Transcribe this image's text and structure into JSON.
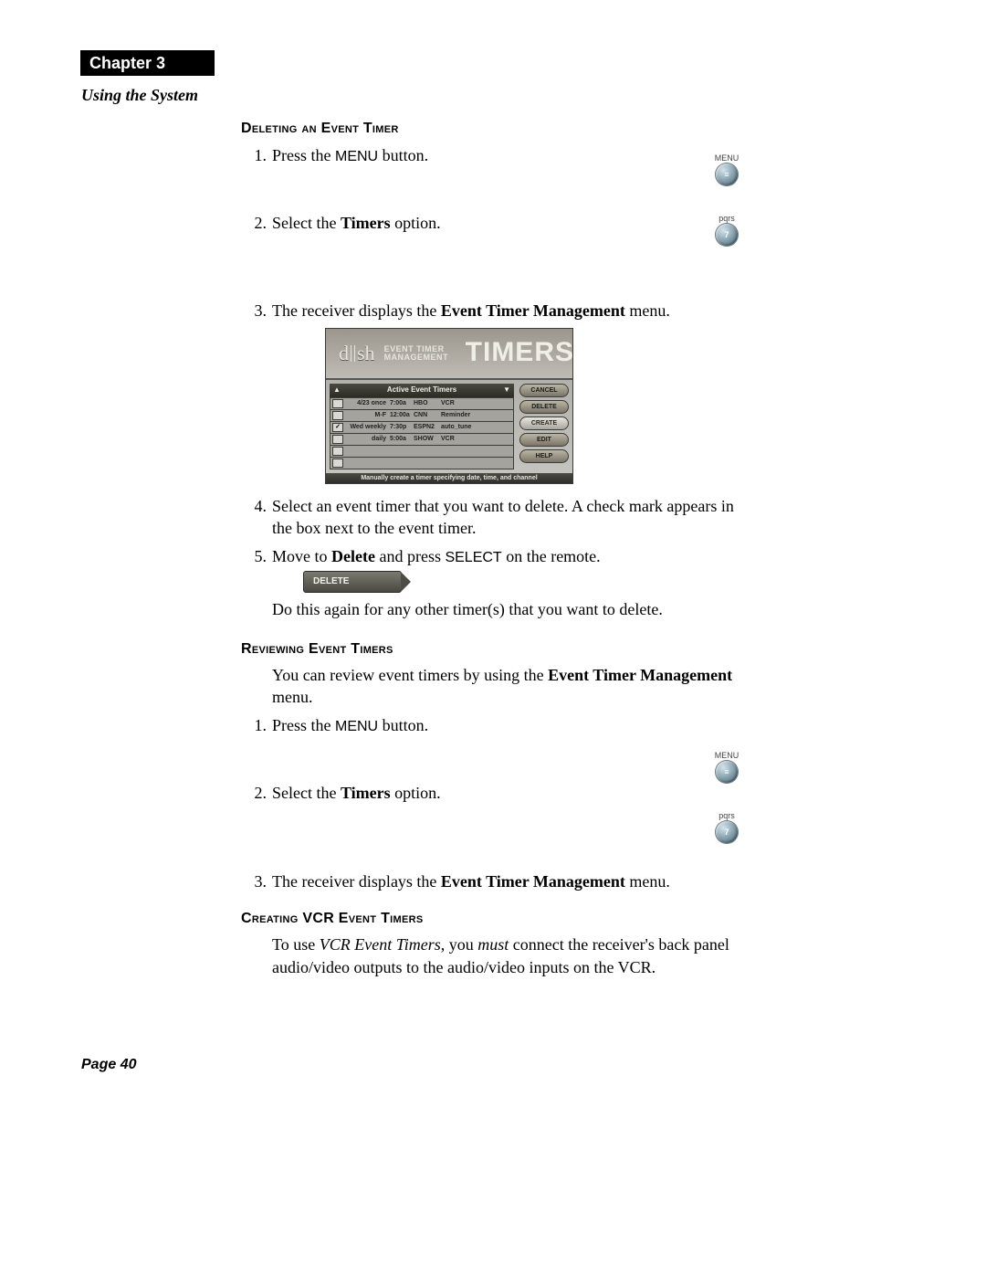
{
  "chapter": {
    "label": "Chapter 3"
  },
  "section": {
    "title": "Using the System"
  },
  "footer": {
    "page": "Page 40"
  },
  "headings": {
    "deleting": "Deleting an Event Timer",
    "reviewing": "Reviewing Event Timers",
    "creating_vcr": "Creating VCR Event Timers"
  },
  "remote": {
    "menu_label": "MENU",
    "menu_glyph": "≡",
    "pqrs_label": "pqrs",
    "seven": "7"
  },
  "body": {
    "press_menu_pre": "Press the ",
    "press_menu_caps": "MENU",
    "press_menu_post": " button.",
    "select_timers_pre": "Select the ",
    "select_timers_bold": "Timers",
    "select_timers_post": " option.",
    "displays_etm_pre": "The receiver displays the ",
    "displays_etm_bold": "Event Timer Management",
    "displays_etm_post": " menu.",
    "step4": "Select an event timer that you want to delete. A check mark appears in the box next to the event timer.",
    "step5_pre": "Move to ",
    "step5_bold": "Delete",
    "step5_mid": " and press ",
    "step5_caps": "SELECT",
    "step5_post": " on the remote.",
    "step5_followup": "Do this again for any other timer(s) that you want to delete.",
    "review_intro_pre": "You can review event timers by using the ",
    "review_intro_bold": "Event Timer Management",
    "review_intro_post": " menu.",
    "vcr_pre": "To use ",
    "vcr_italic": "VCR Event Timers",
    "vcr_mid1": ", you ",
    "vcr_must": "must",
    "vcr_post": " connect the receiver's back panel audio/video outputs to the audio/video inputs on the VCR."
  },
  "etm": {
    "brand": "d sh",
    "title_l1": "EVENT TIMER",
    "title_l2": "MANAGEMENT",
    "bigword": "TIMERS",
    "list_header": "Active Event Timers",
    "tip": "Manually create a timer specifying date, time, and channel",
    "buttons": {
      "cancel": "CANCEL",
      "delete": "DELETE",
      "create": "CREATE",
      "edit": "EDIT",
      "help": "HELP"
    },
    "rows": [
      {
        "chk": "",
        "c1": "4/23  once",
        "c2": "7:00a",
        "c3": "HBO",
        "c4": "VCR"
      },
      {
        "chk": "",
        "c1": "M-F",
        "c2": "12:00a",
        "c3": "CNN",
        "c4": "Reminder"
      },
      {
        "chk": "✓",
        "c1": "Wed weekly",
        "c2": "7:30p",
        "c3": "ESPN2",
        "c4": "auto_tune"
      },
      {
        "chk": "",
        "c1": "daily",
        "c2": "5:00a",
        "c3": "SHOW",
        "c4": "VCR"
      }
    ]
  },
  "delete_pill": {
    "label": "DELETE"
  },
  "numbers": {
    "n1": "1.",
    "n2": "2.",
    "n3": "3.",
    "n4": "4.",
    "n5": "5."
  }
}
